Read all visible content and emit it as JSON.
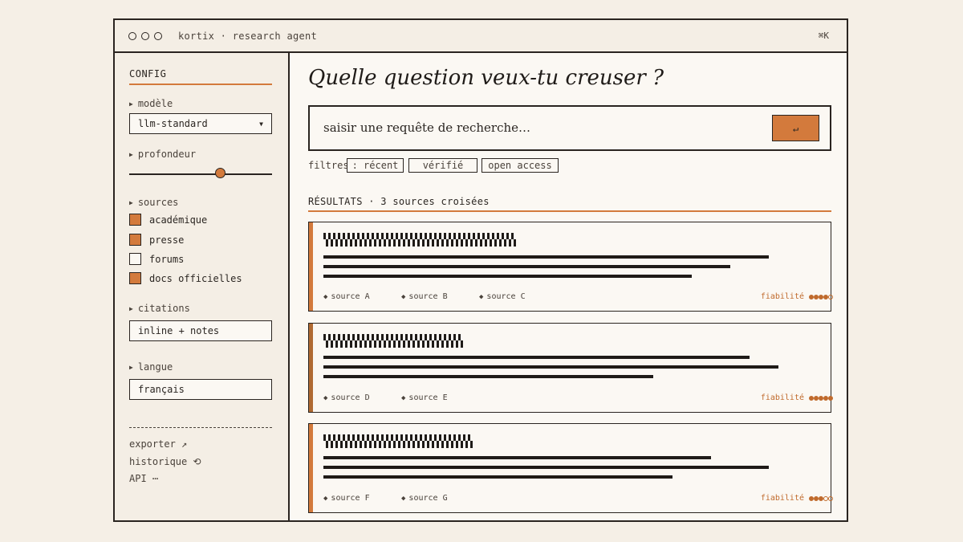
{
  "window": {
    "title": "kortix · research agent",
    "shortcut": "⌘K"
  },
  "sidebar": {
    "config_label": "CONFIG",
    "model": {
      "label": "modèle",
      "value": "llm-standard"
    },
    "depth": {
      "label": "profondeur",
      "value_fraction": 0.64
    },
    "sources": {
      "label": "sources",
      "items": [
        {
          "label": "académique",
          "checked": true
        },
        {
          "label": "presse",
          "checked": true
        },
        {
          "label": "forums",
          "checked": false
        },
        {
          "label": "docs officielles",
          "checked": true
        }
      ]
    },
    "citations": {
      "label": "citations",
      "value": "inline + notes"
    },
    "language": {
      "label": "langue",
      "value": "français"
    },
    "links": [
      {
        "label": "exporter ↗"
      },
      {
        "label": "historique ⟲"
      },
      {
        "label": "API ⋯"
      }
    ]
  },
  "main": {
    "question": "Quelle question veux-tu creuser ?",
    "search": {
      "placeholder": "saisir une requête de recherche…",
      "submit_label": "↵"
    },
    "filters": {
      "label": "filtres",
      "chips": [
        ": récent",
        "vérifié",
        "open access"
      ]
    },
    "results_header": "RÉSULTATS · 3 sources croisées",
    "results": [
      {
        "sources": [
          "source A",
          "source B",
          "source C"
        ],
        "reliability_label": "fiabilité",
        "reliability": 4,
        "reliability_max": 5
      },
      {
        "sources": [
          "source D",
          "source E"
        ],
        "reliability_label": "fiabilité",
        "reliability": 5,
        "reliability_max": 5
      },
      {
        "sources": [
          "source F",
          "source G"
        ],
        "reliability_label": "fiabilité",
        "reliability": 3,
        "reliability_max": 5
      }
    ]
  },
  "colors": {
    "accent": "#d37a3c",
    "ink": "#2a2420",
    "paper": "#fbf8f3",
    "background": "#f5efe6"
  }
}
